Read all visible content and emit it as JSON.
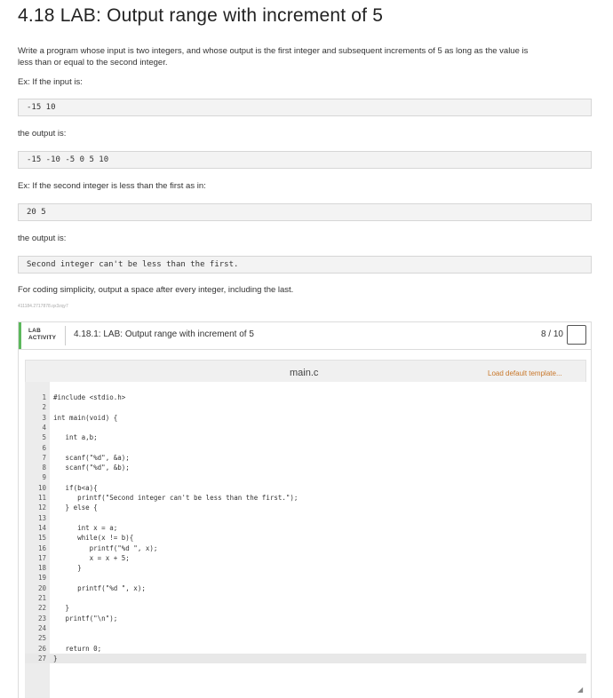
{
  "title": "4.18 LAB: Output range with increment of 5",
  "description_line1": "Write a program whose input is two integers, and whose output is the first integer and subsequent increments of 5 as long as the value is",
  "description_line2": "less than or equal to the second integer.",
  "ex1_label": "Ex: If the input is:",
  "ex1_input": "-15 10",
  "ex1_output_label": "the output is:",
  "ex1_output": "-15 -10 -5 0 5 10",
  "ex2_label": "Ex: If the second integer is less than the first as in:",
  "ex2_input": "20 5",
  "ex2_output_label": "the output is:",
  "ex2_output": "Second integer can't be less than the first.",
  "note": "For coding simplicity, output a space after every integer, including the last.",
  "tiny_id": "411184.2717878.qx3zqy7",
  "lab": {
    "tag_line1": "LAB",
    "tag_line2": "ACTIVITY",
    "title": "4.18.1: LAB: Output range with increment of 5",
    "score": "8 / 10"
  },
  "editor": {
    "filename": "main.c",
    "load_template": "Load default template...",
    "lines": [
      {
        "n": "1",
        "code": "#include <stdio.h>"
      },
      {
        "n": "2",
        "code": ""
      },
      {
        "n": "3",
        "code": "int main(void) {"
      },
      {
        "n": "4",
        "code": ""
      },
      {
        "n": "5",
        "code": "   int a,b;"
      },
      {
        "n": "6",
        "code": ""
      },
      {
        "n": "7",
        "code": "   scanf(\"%d\", &a);"
      },
      {
        "n": "8",
        "code": "   scanf(\"%d\", &b);"
      },
      {
        "n": "9",
        "code": ""
      },
      {
        "n": "10",
        "code": "   if(b<a){"
      },
      {
        "n": "11",
        "code": "      printf(\"Second integer can't be less than the first.\");"
      },
      {
        "n": "12",
        "code": "   } else {"
      },
      {
        "n": "13",
        "code": ""
      },
      {
        "n": "14",
        "code": "      int x = a;"
      },
      {
        "n": "15",
        "code": "      while(x != b){"
      },
      {
        "n": "16",
        "code": "         printf(\"%d \", x);"
      },
      {
        "n": "17",
        "code": "         x = x + 5;"
      },
      {
        "n": "18",
        "code": "      }"
      },
      {
        "n": "19",
        "code": ""
      },
      {
        "n": "20",
        "code": "      printf(\"%d \", x);"
      },
      {
        "n": "21",
        "code": ""
      },
      {
        "n": "22",
        "code": "   }"
      },
      {
        "n": "23",
        "code": "   printf(\"\\n\");"
      },
      {
        "n": "24",
        "code": ""
      },
      {
        "n": "25",
        "code": ""
      },
      {
        "n": "26",
        "code": "   return 0;"
      },
      {
        "n": "27",
        "code": "}"
      }
    ]
  }
}
